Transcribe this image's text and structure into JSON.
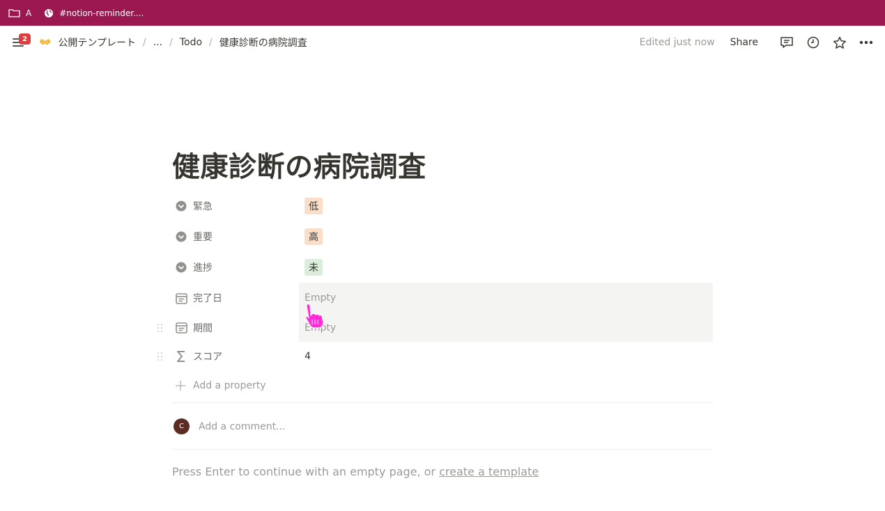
{
  "bookmarks": [
    {
      "icon": "folder-icon",
      "label": "A"
    },
    {
      "icon": "globe-icon",
      "label": "#notion-reminder...."
    }
  ],
  "topbar": {
    "notification_count": "2",
    "breadcrumbs": [
      "公開テンプレート",
      "...",
      "Todo",
      "健康診断の病院調査"
    ],
    "edited": "Edited just now",
    "share": "Share"
  },
  "page": {
    "title": "健康診断の病院調査",
    "properties": [
      {
        "icon": "select-icon",
        "label": "緊急",
        "value": "低",
        "tag_color": "#fadec9"
      },
      {
        "icon": "select-icon",
        "label": "重要",
        "value": "高",
        "tag_color": "#fadec9"
      },
      {
        "icon": "select-icon",
        "label": "進捗",
        "value": "未",
        "tag_color": "#dbeddb"
      },
      {
        "icon": "calendar-icon",
        "label": "完了日",
        "value": "Empty"
      },
      {
        "icon": "calendar-icon",
        "label": "期間",
        "value": "Empty"
      },
      {
        "icon": "sigma-icon",
        "label": "スコア",
        "value": "4"
      }
    ],
    "add_property": "Add a property",
    "comment": {
      "avatar_initial": "C",
      "placeholder": "Add a comment..."
    },
    "hint_prefix": "Press Enter to continue with an empty page, or ",
    "hint_link": "create a template"
  },
  "colors": {
    "bookmark_bar": "#9b1750",
    "badge": "#e03e3e",
    "cursor": "#ff2bd6"
  }
}
